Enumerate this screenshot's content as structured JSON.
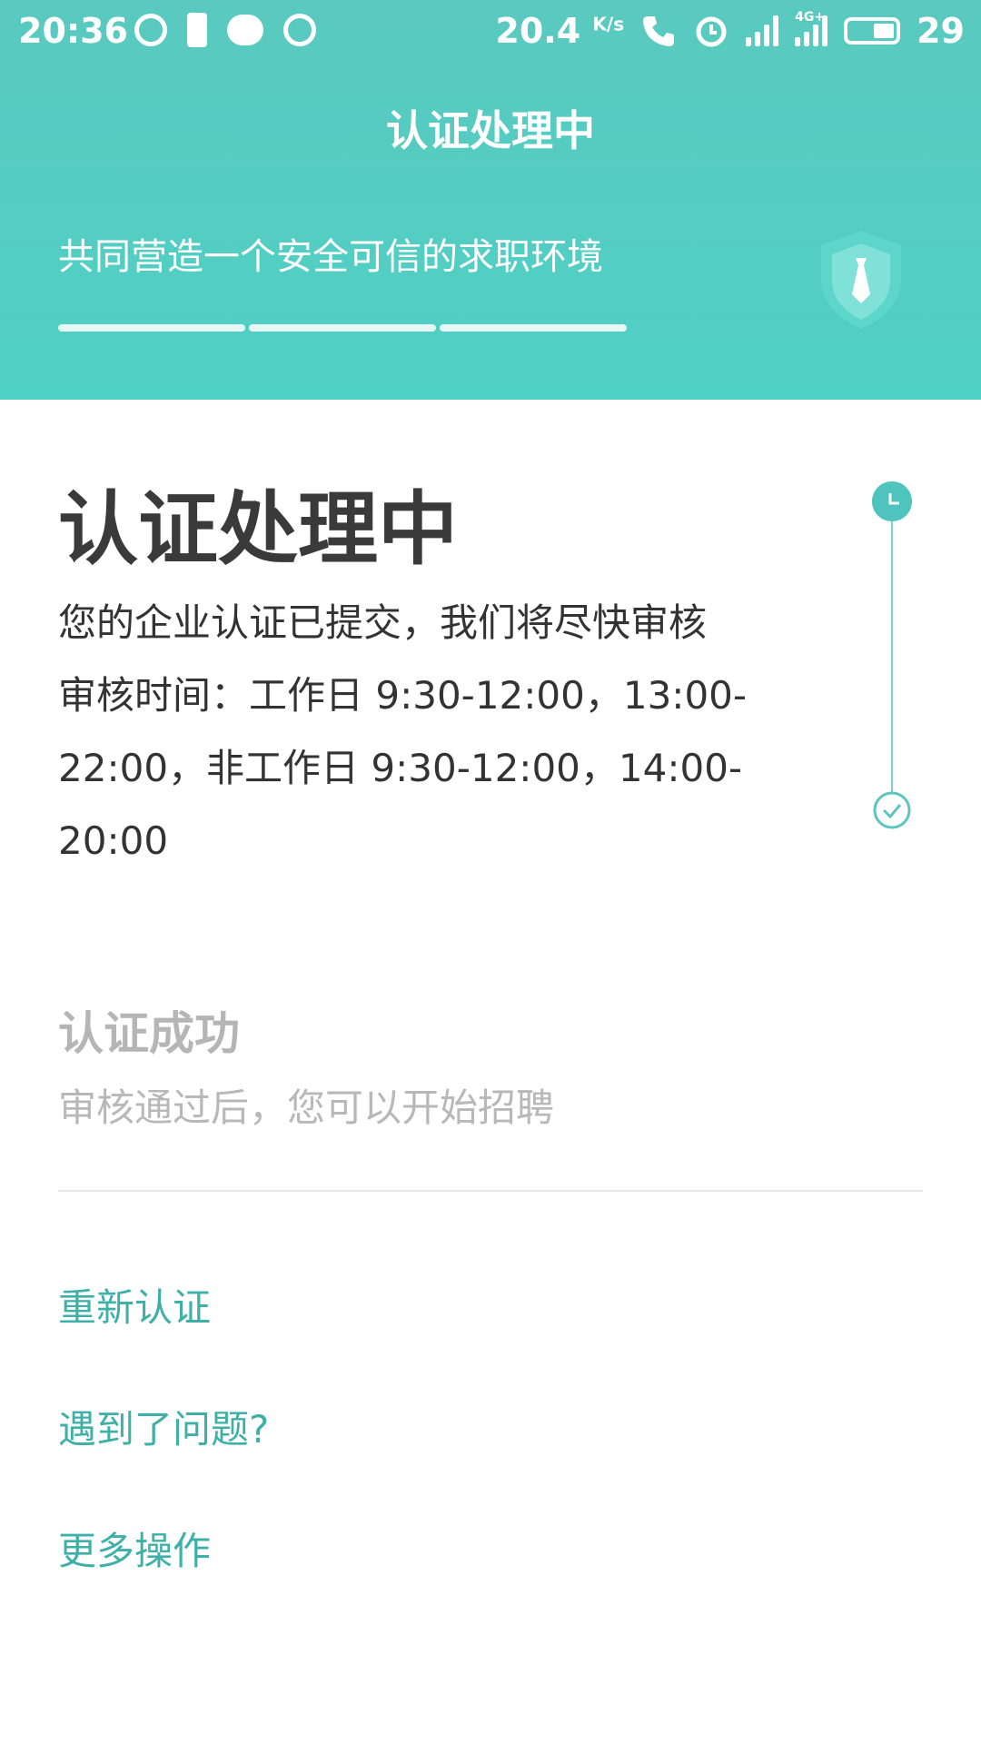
{
  "status_bar": {
    "time": "20:36",
    "speed": "20.4",
    "speed_unit": "K/s",
    "network": "4G+",
    "battery": "29"
  },
  "header": {
    "title": "认证处理中",
    "slogan": "共同营造一个安全可信的求职环境"
  },
  "main": {
    "title": "认证处理中",
    "desc_lines": [
      "您的企业认证已提交，我们将尽快审核",
      "审核时间：工作日 9:30-12:00，13:00-",
      "22:00，非工作日 9:30-12:00，14:00-",
      "20:00"
    ],
    "success_title": "认证成功",
    "success_desc": "审核通过后，您可以开始招聘"
  },
  "links": {
    "reauth": "重新认证",
    "problem": "遇到了问题?",
    "more": "更多操作"
  },
  "colors": {
    "header_bg": "#55cbc1",
    "accent": "#3fb0a8"
  }
}
